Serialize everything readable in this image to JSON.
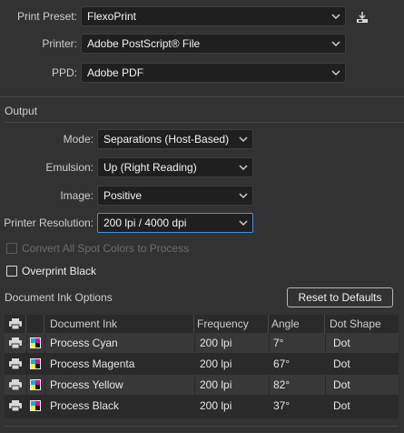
{
  "print_preset": {
    "label": "Print Preset:",
    "value": "FlexoPrint"
  },
  "printer": {
    "label": "Printer:",
    "value": "Adobe PostScript® File"
  },
  "ppd": {
    "label": "PPD:",
    "value": "Adobe PDF"
  },
  "output": {
    "title": "Output",
    "mode": {
      "label": "Mode:",
      "value": "Separations (Host-Based)"
    },
    "emulsion": {
      "label": "Emulsion:",
      "value": "Up (Right Reading)"
    },
    "image": {
      "label": "Image:",
      "value": "Positive"
    },
    "resolution": {
      "label": "Printer Resolution:",
      "value": "200 lpi / 4000 dpi"
    },
    "convert_spot": {
      "label": "Convert All Spot Colors to Process",
      "checked": false,
      "disabled": true
    },
    "overprint_black": {
      "label": "Overprint Black",
      "checked": false
    }
  },
  "ink_options": {
    "title": "Document Ink Options",
    "reset_button": "Reset to Defaults",
    "columns": {
      "ink": "Document Ink",
      "frequency": "Frequency",
      "angle": "Angle",
      "dot_shape": "Dot Shape"
    },
    "rows": [
      {
        "ink": "Process Cyan",
        "frequency": "200 lpi",
        "angle": "7°",
        "dot_shape": "Dot"
      },
      {
        "ink": "Process Magenta",
        "frequency": "200 lpi",
        "angle": "67°",
        "dot_shape": "Dot"
      },
      {
        "ink": "Process Yellow",
        "frequency": "200 lpi",
        "angle": "82°",
        "dot_shape": "Dot"
      },
      {
        "ink": "Process Black",
        "frequency": "200 lpi",
        "angle": "37°",
        "dot_shape": "Dot"
      }
    ]
  },
  "colors": {
    "background": "#323232",
    "field": "#1f1f1f",
    "focus": "#4a8fd8"
  }
}
